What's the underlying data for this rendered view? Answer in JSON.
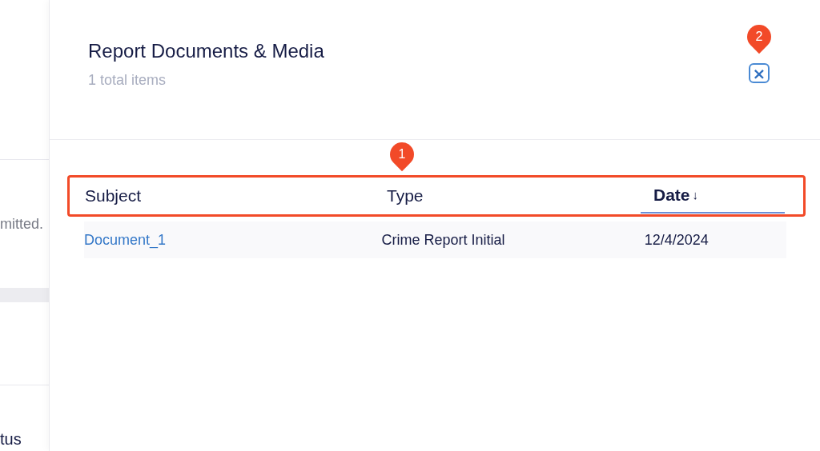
{
  "background": {
    "texts": [
      "mitted.",
      "tus"
    ]
  },
  "panel": {
    "title": "Report Documents & Media",
    "subtitle": "1 total items",
    "close_icon": "×"
  },
  "table": {
    "columns": [
      {
        "label": "Subject",
        "selected": false
      },
      {
        "label": "Type",
        "selected": false
      },
      {
        "label": "Date",
        "selected": true,
        "sort_mark": "↓"
      }
    ],
    "rows": [
      {
        "cells": [
          "Document_1",
          "Crime Report Initial",
          "12/4/2024"
        ]
      }
    ]
  },
  "annotations": [
    {
      "label": "1"
    },
    {
      "label": "2"
    }
  ]
}
